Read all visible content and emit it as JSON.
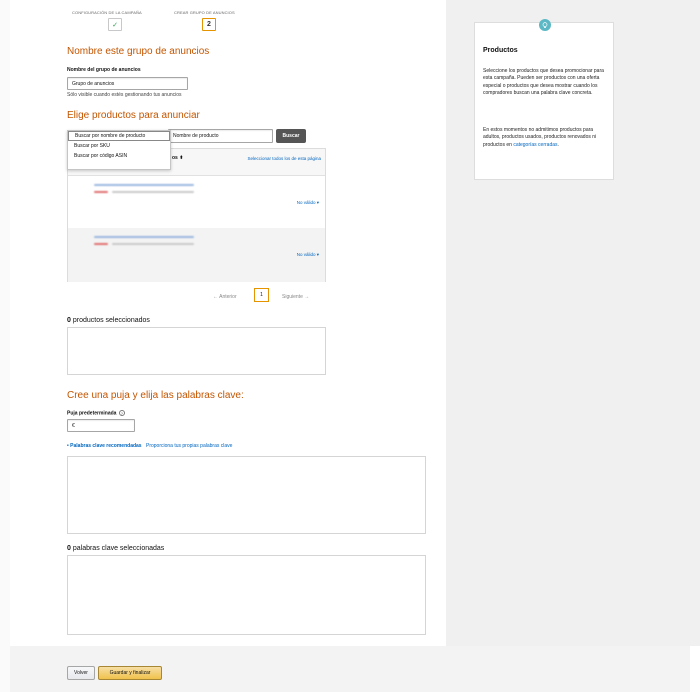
{
  "stepper": {
    "step1_label": "CONFIGURACIÓN DE LA CAMPAÑA",
    "step2_label": "CREAR GRUPO DE ANUNCIOS",
    "step1_mark": "✓",
    "step2_number": "2"
  },
  "ad_group": {
    "heading": "Nombre este grupo de anuncios",
    "field_label": "Nombre del grupo de anuncios",
    "field_value": "Grupo de anuncios",
    "helper": "Sólo visible cuando estés gestionando tus anuncios"
  },
  "products": {
    "heading": "Elige productos para anunciar",
    "search_mode_options": [
      "Buscar por nombre de producto",
      "Buscar por SKU",
      "Buscar por código ASIN"
    ],
    "selected_option": "Buscar por nombre de producto",
    "search_placeholder": "Nombre de producto",
    "search_button": "Buscar",
    "column_header_suffix": "os ⬍",
    "select_all_link": "Seleccionar todos los de esta página",
    "rows": [
      {
        "status": "No válido ▾"
      },
      {
        "status": "No válido ▾"
      }
    ],
    "pager": {
      "prev": "← Anterior",
      "page": "1",
      "next": "Siguiente →"
    },
    "selected_count": "0",
    "selected_label": " productos seleccionados"
  },
  "bids": {
    "heading": "Cree una puja y elija las palabras clave:",
    "default_bid_label": "Puja predeterminada",
    "help_icon": "?",
    "bid_value": "€",
    "tab_recommended": "Palabras clave recomendadas",
    "tab_own": "Proporciona tus propias palabras clave",
    "keywords_count": "0",
    "keywords_label": " palabras clave seleccionadas"
  },
  "info_card": {
    "title": "Productos",
    "paragraph1": "Seleccione los productos que desea promocionar para esta campaña. Pueden ser productos con una oferta especial o productos que desea mostrar cuando los compradores buscan una palabra clave concreta.",
    "paragraph2_prefix": "En estos momentos no admitimos productos para adultos, productos usados, productos renovados ni productos en ",
    "paragraph2_link": "categorías cerradas",
    "paragraph2_suffix": "."
  },
  "footer": {
    "back_button": "Volver",
    "save_button": "Guardar y finalizar"
  },
  "colors": {
    "heading_orange": "#c45500",
    "link_blue": "#0066c0",
    "step_accent": "#e59400",
    "primary_button": "#f0c14b"
  }
}
